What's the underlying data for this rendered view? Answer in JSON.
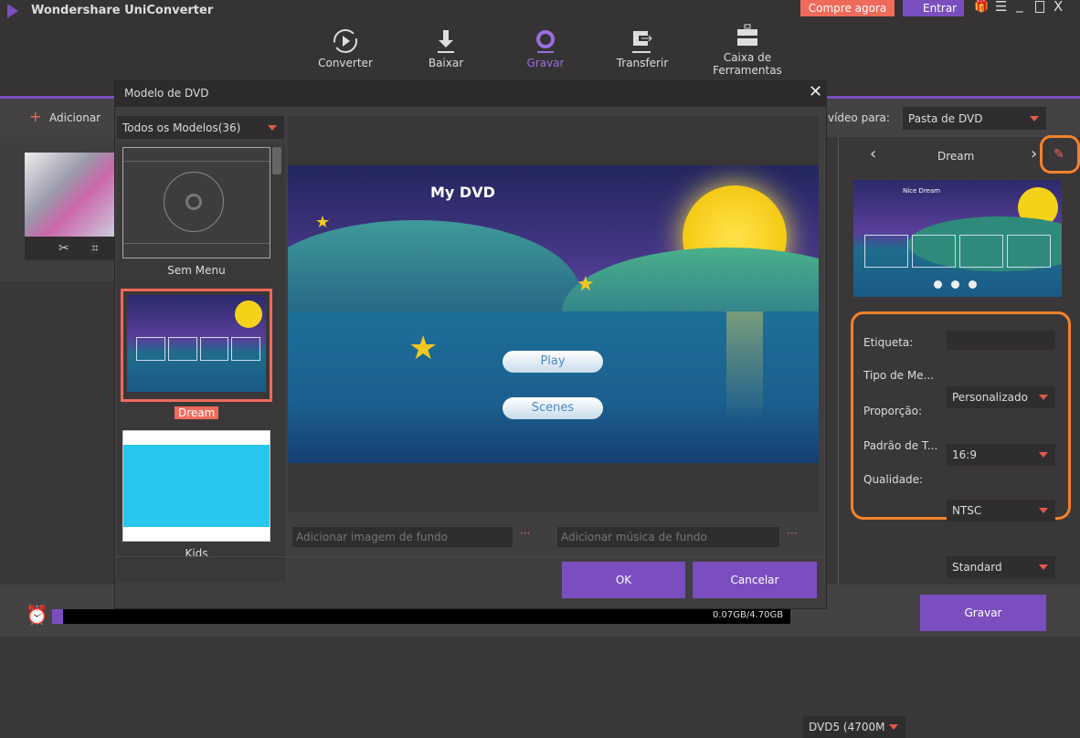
{
  "app": {
    "title": "Wondershare UniConverter",
    "buy_label": "Compre agora",
    "login_label": "Entrar"
  },
  "nav": [
    {
      "label": "Converter",
      "icon": "convert-icon"
    },
    {
      "label": "Baixar",
      "icon": "download-icon"
    },
    {
      "label": "Gravar",
      "icon": "burn-icon",
      "active": true
    },
    {
      "label": "Transferir",
      "icon": "transfer-icon"
    },
    {
      "label": "Caixa de Ferramentas",
      "icon": "toolbox-icon"
    }
  ],
  "toolbar": {
    "add_label": "Adicionar",
    "burn_to_label": "vídeo para:",
    "burn_to_value": "Pasta de DVD"
  },
  "dialog": {
    "title": "Modelo de DVD",
    "filter": "Todos os Modelos(36)",
    "templates": [
      {
        "label": "Sem Menu"
      },
      {
        "label": "Dream",
        "selected": true
      },
      {
        "label": "Kids"
      }
    ],
    "preview": {
      "title": "My DVD",
      "play": "Play",
      "scenes": "Scenes"
    },
    "bg_image_placeholder": "Adicionar imagem de fundo",
    "bg_music_placeholder": "Adicionar música de fundo",
    "more": "···",
    "ok": "OK",
    "cancel": "Cancelar"
  },
  "right": {
    "template_name": "Dream",
    "thumb_title": "Nice Dream",
    "fields": [
      {
        "label": "Etiqueta:",
        "value": ""
      },
      {
        "label": "Tipo de Me...",
        "value": "Personalizado"
      },
      {
        "label": "Proporção:",
        "value": "16:9"
      },
      {
        "label": "Padrão de T...",
        "value": "NTSC"
      },
      {
        "label": "Qualidade:",
        "value": "Standard"
      }
    ]
  },
  "bottom": {
    "usage": "0.07GB/4.70GB",
    "usage_fraction": 0.015,
    "disc": "DVD5 (4700M",
    "burn": "Gravar"
  },
  "colors": {
    "accent": "#7b4ec0",
    "highlight": "#f5822a",
    "buy": "#f06a5b"
  }
}
